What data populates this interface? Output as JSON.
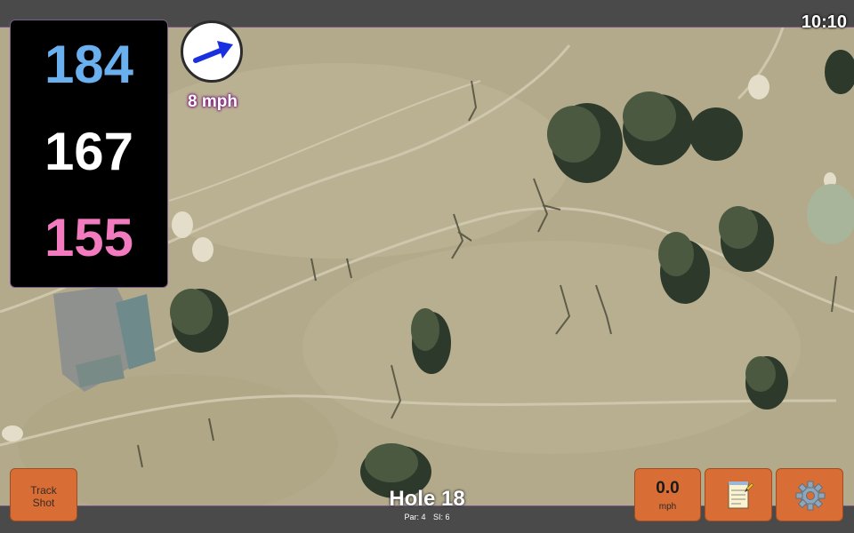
{
  "status": {
    "time": "10:10"
  },
  "distances": {
    "back": "184",
    "middle": "167",
    "front": "155"
  },
  "wind": {
    "label": "8 mph",
    "direction_icon": "arrow-up-right-icon"
  },
  "hole": {
    "title": "Hole 18",
    "par": "Par: 4",
    "si": "SI: 6"
  },
  "buttons": {
    "track_shot": [
      "Track",
      "Shot"
    ],
    "wind_value": "0.0",
    "wind_unit": "mph",
    "notes_icon": "notepad-icon",
    "settings_icon": "gear-icon"
  },
  "colors": {
    "back": "#6ab0ee",
    "middle": "#ffffff",
    "front": "#f27bbf",
    "button": "#d86e35",
    "bar": "#4a4a4a"
  }
}
